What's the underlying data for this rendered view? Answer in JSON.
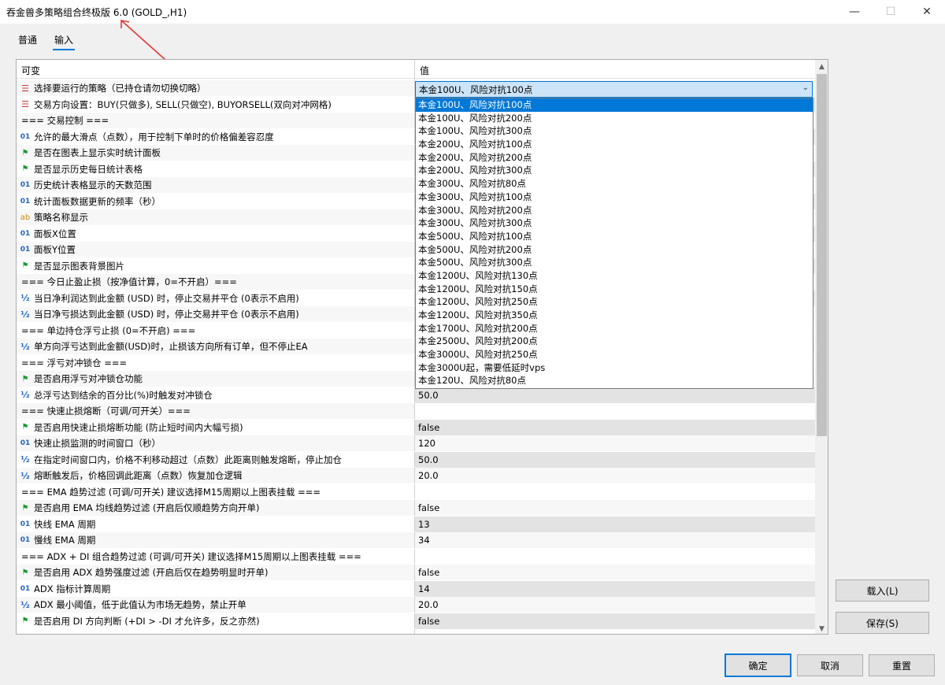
{
  "window": {
    "title": "吞金兽多策略组合终极版 6.0 (GOLD_,H1)",
    "minimize_glyph": "—",
    "maximize_glyph": "☐",
    "close_glyph": "✕"
  },
  "tabs": [
    {
      "label": "普通",
      "active": false
    },
    {
      "label": "输入",
      "active": true
    }
  ],
  "table": {
    "header_name": "可变",
    "header_value": "值",
    "rows": [
      {
        "icon": "enum",
        "name": "选择要运行的策略（已持仓请勿切换切略）",
        "value": ""
      },
      {
        "icon": "enum",
        "name": "交易方向设置：BUY(只做多), SELL(只做空), BUYORSELL(双向对冲网格)",
        "value": ""
      },
      {
        "icon": "",
        "name": "=== 交易控制 ===",
        "value": ""
      },
      {
        "icon": "num",
        "name": "允许的最大滑点（点数），用于控制下单时的价格偏差容忍度",
        "value": ""
      },
      {
        "icon": "flag",
        "name": "是否在图表上显示实时统计面板",
        "value": ""
      },
      {
        "icon": "flag",
        "name": "是否显示历史每日统计表格",
        "value": ""
      },
      {
        "icon": "num",
        "name": "历史统计表格显示的天数范围",
        "value": ""
      },
      {
        "icon": "num",
        "name": "统计面板数据更新的频率（秒）",
        "value": ""
      },
      {
        "icon": "ab",
        "name": "策略名称显示",
        "value": ""
      },
      {
        "icon": "num",
        "name": "面板X位置",
        "value": ""
      },
      {
        "icon": "num",
        "name": "面板Y位置",
        "value": ""
      },
      {
        "icon": "flag",
        "name": "是否显示图表背景图片",
        "value": ""
      },
      {
        "icon": "",
        "name": "=== 今日止盈止损（按净值计算，0=不开启）===",
        "value": ""
      },
      {
        "icon": "dbl",
        "name": "当日净利润达到此金额 (USD) 时，停止交易并平仓 (0表示不启用)",
        "value": ""
      },
      {
        "icon": "dbl",
        "name": "当日净亏损达到此金额 (USD) 时，停止交易并平仓 (0表示不启用)",
        "value": ""
      },
      {
        "icon": "",
        "name": "=== 单边持仓浮亏止损 (0=不开启) ===",
        "value": ""
      },
      {
        "icon": "dbl",
        "name": "单方向浮亏达到此金额(USD)时，止损该方向所有订单，但不停止EA",
        "value": ""
      },
      {
        "icon": "",
        "name": "=== 浮亏对冲锁仓 ===",
        "value": ""
      },
      {
        "icon": "flag",
        "name": "是否启用浮亏对冲锁仓功能",
        "value": ""
      },
      {
        "icon": "dbl",
        "name": "总浮亏达到结余的百分比(%)时触发对冲锁仓",
        "value": "50.0"
      },
      {
        "icon": "",
        "name": "=== 快速止损熔断（可调/可开关）===",
        "value": ""
      },
      {
        "icon": "flag",
        "name": "是否启用快速止损熔断功能 (防止短时间内大幅亏损)",
        "value": "false"
      },
      {
        "icon": "num",
        "name": "快速止损监测的时间窗口（秒）",
        "value": "120"
      },
      {
        "icon": "dbl",
        "name": "在指定时间窗口内，价格不利移动超过（点数）此距离则触发熔断，停止加仓",
        "value": "50.0"
      },
      {
        "icon": "dbl",
        "name": "熔断触发后，价格回调此距离（点数）恢复加仓逻辑",
        "value": "20.0"
      },
      {
        "icon": "",
        "name": "=== EMA 趋势过滤 (可调/可开关) 建议选择M15周期以上图表挂载 ===",
        "value": ""
      },
      {
        "icon": "flag",
        "name": "是否启用 EMA 均线趋势过滤 (开启后仅顺趋势方向开单)",
        "value": "false"
      },
      {
        "icon": "num",
        "name": "快线 EMA 周期",
        "value": "13"
      },
      {
        "icon": "num",
        "name": "慢线 EMA 周期",
        "value": "34"
      },
      {
        "icon": "",
        "name": "=== ADX + DI 组合趋势过滤 (可调/可开关) 建议选择M15周期以上图表挂载 ===",
        "value": ""
      },
      {
        "icon": "flag",
        "name": "是否启用 ADX 趋势强度过滤 (开启后仅在趋势明显时开单)",
        "value": "false"
      },
      {
        "icon": "num",
        "name": "ADX 指标计算周期",
        "value": "14"
      },
      {
        "icon": "dbl",
        "name": "ADX 最小阈值，低于此值认为市场无趋势，禁止开单",
        "value": "20.0"
      },
      {
        "icon": "flag",
        "name": "是否启用 DI 方向判断 (+DI > -DI 才允许多，反之亦然)",
        "value": "false"
      }
    ]
  },
  "icon_glyphs": {
    "num": "01",
    "dbl": "½",
    "ab": "ab",
    "flag": "⚑",
    "enum": "☰"
  },
  "combo": {
    "selected": "本金100U、风险对抗100点",
    "arrow": "⌄"
  },
  "dropdown_options": [
    "本金100U、风险对抗100点",
    "本金100U、风险对抗200点",
    "本金100U、风险对抗300点",
    "本金200U、风险对抗100点",
    "本金200U、风险对抗200点",
    "本金200U、风险对抗300点",
    "本金300U、风险对抗80点",
    "本金300U、风险对抗100点",
    "本金300U、风险对抗200点",
    "本金300U、风险对抗300点",
    "本金500U、风险对抗100点",
    "本金500U、风险对抗200点",
    "本金500U、风险对抗300点",
    "本金1200U、风险对抗130点",
    "本金1200U、风险对抗150点",
    "本金1200U、风险对抗250点",
    "本金1200U、风险对抗350点",
    "本金1700U、风险对抗200点",
    "本金2500U、风险对抗200点",
    "本金3000U、风险对抗250点",
    "本金3000U起，需要低延时vps",
    "本金120U、风险对抗80点"
  ],
  "side_buttons": {
    "load": "载入(L)",
    "save": "保存(S)"
  },
  "bottom_buttons": {
    "ok": "确定",
    "cancel": "取消",
    "reset": "重置"
  },
  "scroll": {
    "up": "▲",
    "down": "▼"
  }
}
